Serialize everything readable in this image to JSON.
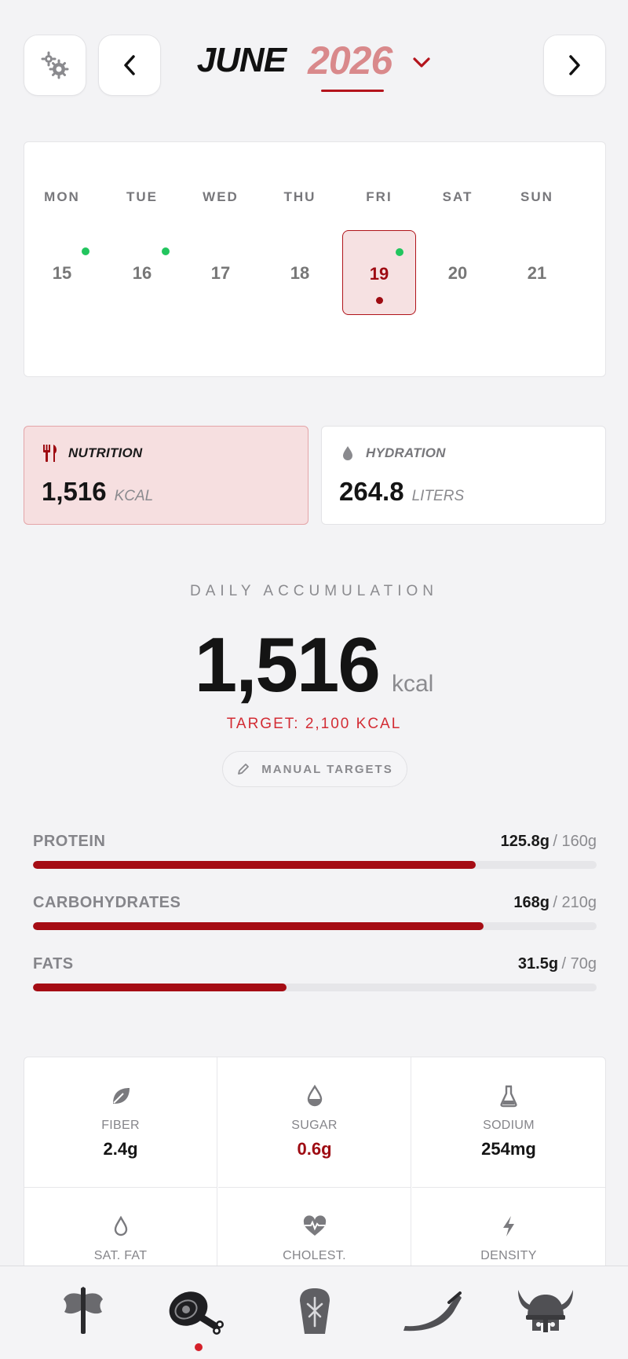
{
  "header": {
    "month": "JUNE",
    "year": "2026",
    "settings_icon": "gears-icon",
    "prev_icon": "chevron-left-icon",
    "next_icon": "chevron-right-icon",
    "dropdown_icon": "chevron-down-icon",
    "accent": "#b4141c"
  },
  "calendar": {
    "weekdays": [
      "MON",
      "TUE",
      "WED",
      "THU",
      "FRI",
      "SAT",
      "SUN"
    ],
    "days": [
      {
        "num": "15",
        "logged": true,
        "selected": false
      },
      {
        "num": "16",
        "logged": true,
        "selected": false
      },
      {
        "num": "17",
        "logged": false,
        "selected": false
      },
      {
        "num": "18",
        "logged": false,
        "selected": false
      },
      {
        "num": "19",
        "logged": true,
        "selected": true
      },
      {
        "num": "20",
        "logged": false,
        "selected": false
      },
      {
        "num": "21",
        "logged": false,
        "selected": false
      }
    ]
  },
  "tabs": [
    {
      "label": "NUTRITION",
      "value": "1,516",
      "unit": "KCAL",
      "icon": "fork-knife-icon",
      "active": true
    },
    {
      "label": "HYDRATION",
      "value": "264.8",
      "unit": "LITERS",
      "icon": "water-drop-icon",
      "active": false
    }
  ],
  "daily": {
    "label": "DAILY ACCUMULATION",
    "value": "1,516",
    "unit": "kcal",
    "target": "TARGET: 2,100 KCAL",
    "manual_button": "MANUAL TARGETS"
  },
  "macros": [
    {
      "name": "PROTEIN",
      "value": "125.8g",
      "total": "/ 160g",
      "fraction": 0.786
    },
    {
      "name": "CARBOHYDRATES",
      "value": "168g",
      "total": "/ 210g",
      "fraction": 0.8
    },
    {
      "name": "FATS",
      "value": "31.5g",
      "total": "/ 70g",
      "fraction": 0.45
    }
  ],
  "micros": [
    {
      "label": "FIBER",
      "value": "2.4g",
      "icon": "leaf-icon",
      "highlight": false
    },
    {
      "label": "SUGAR",
      "value": "0.6g",
      "icon": "drop-half-icon",
      "highlight": true
    },
    {
      "label": "SODIUM",
      "value": "254mg",
      "icon": "flask-icon",
      "highlight": false
    },
    {
      "label": "SAT. FAT",
      "value": "",
      "icon": "drop-outline-icon",
      "highlight": false
    },
    {
      "label": "CHOLEST.",
      "value": "",
      "icon": "heartbeat-icon",
      "highlight": false
    },
    {
      "label": "DENSITY",
      "value": "",
      "icon": "lightning-icon",
      "highlight": false
    }
  ],
  "nav": [
    {
      "name": "axe-icon",
      "active": false
    },
    {
      "name": "meat-leg-icon",
      "active": true
    },
    {
      "name": "rune-stone-icon",
      "active": false
    },
    {
      "name": "drinking-horn-icon",
      "active": false
    },
    {
      "name": "viking-helmet-icon",
      "active": false
    }
  ]
}
